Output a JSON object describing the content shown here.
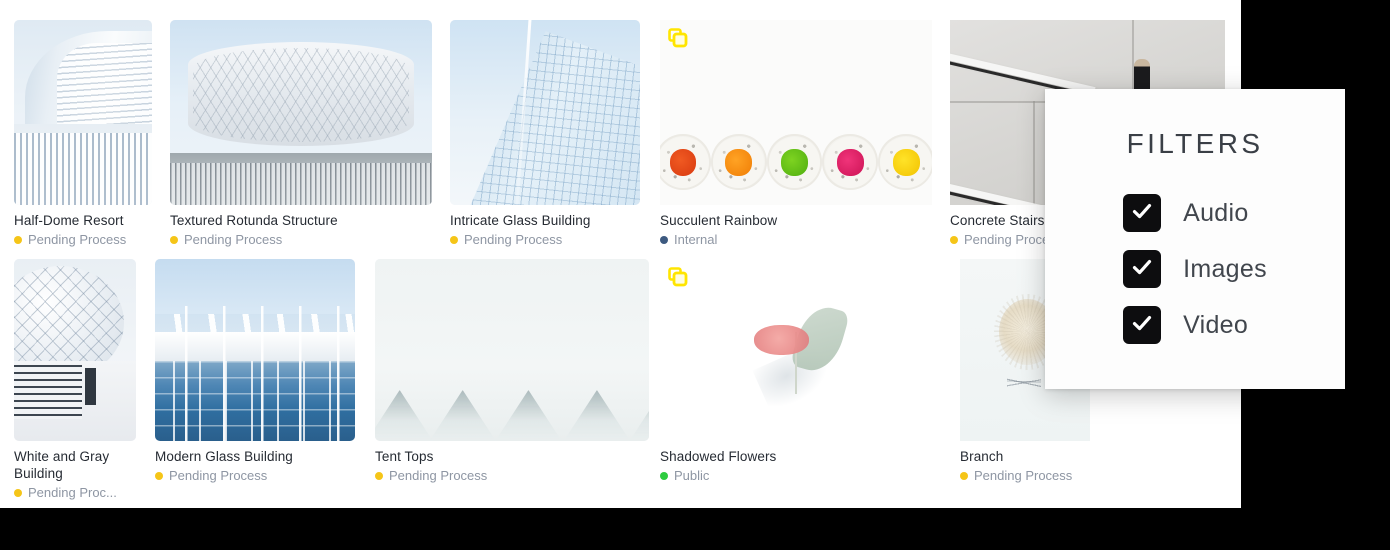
{
  "theme": {
    "surface_bg": "#ffffff",
    "outside_bg": "#000000",
    "title_color": "#262b33",
    "status_color": "#8e96a3",
    "badge_color": "#ffe500",
    "status_colors": {
      "pending": "#f5c518",
      "internal": "#3d5a80",
      "public": "#2ecc40"
    }
  },
  "assets": [
    {
      "title": "Half-Dome Resort",
      "status": "Pending Process",
      "status_type": "pending",
      "badge": null,
      "art": "halfdome"
    },
    {
      "title": "Textured Rotunda Structure",
      "status": "Pending Process",
      "status_type": "pending",
      "badge": null,
      "art": "rotunda"
    },
    {
      "title": "Intricate Glass Building",
      "status": "Pending Process",
      "status_type": "pending",
      "badge": null,
      "art": "glass"
    },
    {
      "title": "Succulent Rainbow",
      "status": "Internal",
      "status_type": "internal",
      "badge": "copy-icon",
      "art": "succulent"
    },
    {
      "title": "Concrete Stairs.j",
      "status": "Pending Proce",
      "status_type": "pending",
      "badge": null,
      "art": "stairs"
    },
    {
      "title": "White and Gray Building",
      "status": "Pending Proc...",
      "status_type": "pending",
      "badge": null,
      "art": "geo"
    },
    {
      "title": "Modern Glass Building",
      "status": "Pending Process",
      "status_type": "pending",
      "badge": null,
      "art": "modern"
    },
    {
      "title": "Tent Tops",
      "status": "Pending Process",
      "status_type": "pending",
      "badge": null,
      "art": "tents"
    },
    {
      "title": "Shadowed Flowers",
      "status": "Public",
      "status_type": "public",
      "badge": "copy-icon",
      "art": "flowers"
    },
    {
      "title": "Branch",
      "status": "Pending Process",
      "status_type": "pending",
      "badge": null,
      "art": "branch"
    }
  ],
  "filters_panel": {
    "title": "FILTERS",
    "options": [
      {
        "label": "Audio",
        "checked": true
      },
      {
        "label": "Images",
        "checked": true
      },
      {
        "label": "Video",
        "checked": true
      }
    ]
  }
}
